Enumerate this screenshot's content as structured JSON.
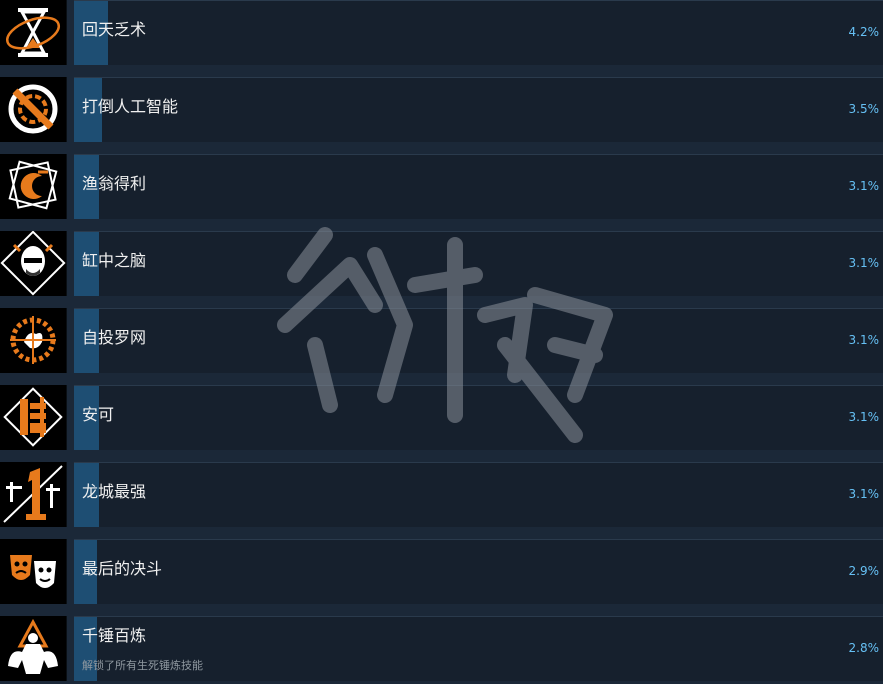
{
  "achievements": [
    {
      "name": "回天乏术",
      "percent": "4.2%",
      "percent_value": 4.2,
      "icon": "hourglass-icon"
    },
    {
      "name": "打倒人工智能",
      "percent": "3.5%",
      "percent_value": 3.5,
      "icon": "no-ai-icon"
    },
    {
      "name": "渔翁得利",
      "percent": "3.1%",
      "percent_value": 3.1,
      "icon": "crescent-icon"
    },
    {
      "name": "缸中之脑",
      "percent": "3.1%",
      "percent_value": 3.1,
      "icon": "bald-man-icon"
    },
    {
      "name": "自投罗网",
      "percent": "3.1%",
      "percent_value": 3.1,
      "icon": "caught-bird-icon"
    },
    {
      "name": "安可",
      "percent": "3.1%",
      "percent_value": 3.1,
      "icon": "calligraphy-icon"
    },
    {
      "name": "龙城最强",
      "percent": "3.1%",
      "percent_value": 3.1,
      "icon": "number-one-icon"
    },
    {
      "name": "最后的决斗",
      "percent": "2.9%",
      "percent_value": 2.9,
      "icon": "masks-icon"
    },
    {
      "name": "千锤百炼",
      "percent": "2.8%",
      "percent_value": 2.8,
      "icon": "muscle-man-icon",
      "description": "解锁了所有生死锤炼技能"
    }
  ],
  "colors": {
    "accent": "#e77a1c",
    "percent_text": "#66c0f4",
    "bar": "#1e4e73"
  }
}
